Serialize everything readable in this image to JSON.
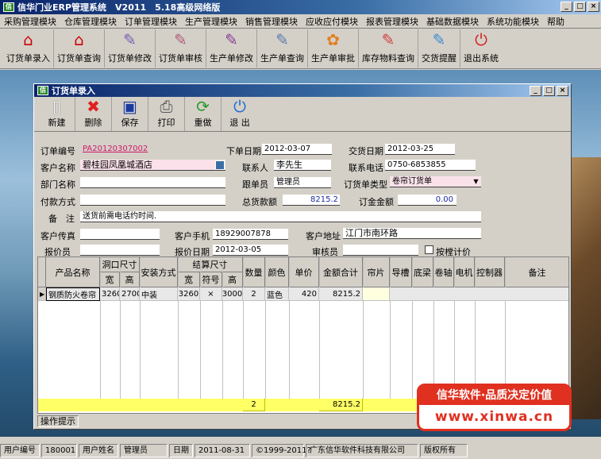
{
  "app": {
    "title": "信华门业ERP管理系统　V2011　5.18高级网络版"
  },
  "menu": [
    "采购管理模块",
    "仓库管理模块",
    "订单管理模块",
    "生产管理模块",
    "销售管理模块",
    "应收应付模块",
    "报表管理模块",
    "基础数据模块",
    "系统功能模块",
    "帮助"
  ],
  "toolbar": [
    "订货单录入",
    "订货单查询",
    "订货单修改",
    "订货单审核",
    "生产单修改",
    "生产单查询",
    "生产单审批",
    "库存物料查询",
    "交货提醒",
    "退出系统"
  ],
  "child": {
    "title": "订货单录入"
  },
  "child_toolbar": [
    "新建",
    "删除",
    "保存",
    "打印",
    "重做",
    "退 出"
  ],
  "form": {
    "order_no_label": "订单编号",
    "order_no": "PA20120307002",
    "order_date_label": "下单日期",
    "order_date": "2012-03-07",
    "delivery_date_label": "交货日期",
    "delivery_date": "2012-03-25",
    "customer_label": "客户名称",
    "customer": "碧桂园凤凰城酒店",
    "contact_label": "联系人",
    "contact": "李先生",
    "phone_label": "联系电话",
    "phone": "0750-6853855",
    "dept_label": "部门名称",
    "dept": "",
    "follower_label": "跟单员",
    "follower": "管理员",
    "order_type_label": "订货单类型",
    "order_type": "卷帘订货单",
    "payment_label": "付款方式",
    "payment": "",
    "total_label": "总货款额",
    "total": "8215.2",
    "deposit_label": "订金金额",
    "deposit": "0.00",
    "remark_label": "备　注",
    "remark": "送货前需电话约时间.",
    "fax_label": "客户传真",
    "fax": "",
    "mobile_label": "客户手机",
    "mobile": "18929007878",
    "address_label": "客户地址",
    "address": "江门市南环路",
    "quoter_label": "报价员",
    "quoter": "",
    "quote_date_label": "报价日期",
    "quote_date": "2012-03-05",
    "auditor_label": "审核员",
    "auditor": "",
    "piece_label": "按樘计价"
  },
  "grid": {
    "headers": {
      "name": "产品名称",
      "hole": "洞口尺寸",
      "w": "宽",
      "h": "高",
      "install": "安装方式",
      "settle": "结算尺寸",
      "sw": "宽",
      "sym": "符号",
      "sh": "高",
      "qty": "数量",
      "color": "颜色",
      "price": "单价",
      "amount": "金额合计",
      "panel": "帘片",
      "rail": "导槽",
      "bottom": "底梁",
      "shaft": "卷轴",
      "motor": "电机",
      "ctrl": "控制器",
      "note": "备注"
    },
    "row": {
      "name": "钢质防火卷帘",
      "w": "3260",
      "h": "2700",
      "install": "中装",
      "sw": "3260",
      "sym": "×",
      "sh": "3000",
      "qty": "2",
      "color": "蓝色",
      "price": "420",
      "amount": "8215.2"
    },
    "sum": {
      "qty": "2",
      "amount": "8215.2"
    }
  },
  "ops_hint": "操作提示",
  "promo": {
    "line1": "信华软件·品质决定价值",
    "line2": "www.xinwa.cn"
  },
  "status": {
    "user_no_label": "用户编号",
    "user_no": "180001",
    "user_name_label": "用户姓名",
    "user_name": "管理员",
    "date_label": "日期",
    "date": "2011-08-31",
    "copyright": "©1999-2011?",
    "company": "广东信华软件科技有限公司",
    "rights": "版权所有"
  }
}
